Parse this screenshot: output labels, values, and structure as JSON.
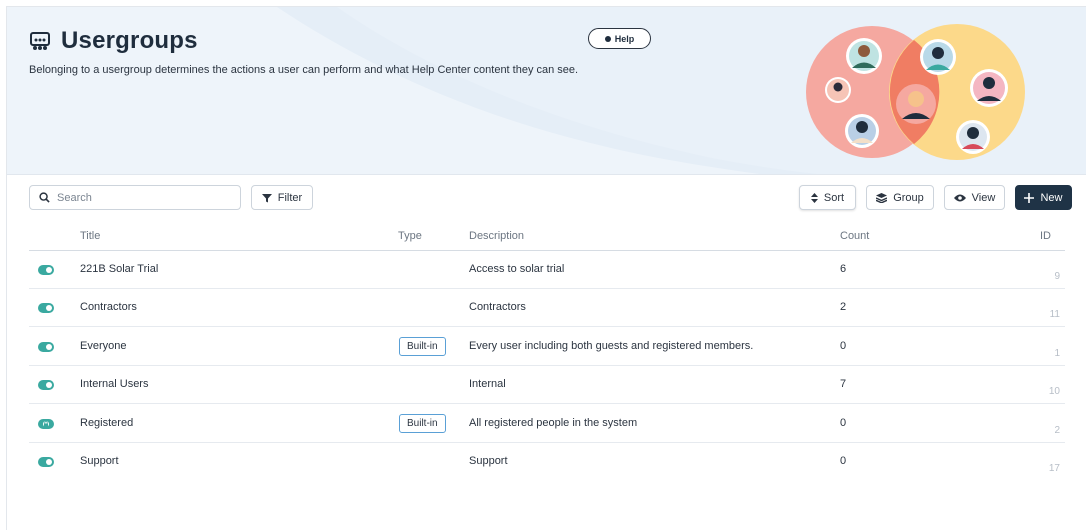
{
  "header": {
    "title": "Usergroups",
    "subtitle": "Belonging to a usergroup determines the actions a user can perform and what Help Center content they can see.",
    "help_label": "Help",
    "title_icon": "usergroup-icon"
  },
  "toolbar": {
    "search_placeholder": "Search",
    "filter_label": "Filter",
    "sort_label": "Sort",
    "group_label": "Group",
    "view_label": "View",
    "new_label": "New"
  },
  "table": {
    "columns": {
      "title": "Title",
      "type": "Type",
      "description": "Description",
      "count": "Count",
      "id": "ID"
    },
    "rows": [
      {
        "title": "221B Solar Trial",
        "type": "",
        "description": "Access to solar trial",
        "count": "6",
        "id": "9",
        "enabled": true,
        "locked": false
      },
      {
        "title": "Contractors",
        "type": "",
        "description": "Contractors",
        "count": "2",
        "id": "11",
        "enabled": true,
        "locked": false
      },
      {
        "title": "Everyone",
        "type": "Built-in",
        "description": "Every user including both guests and registered members.",
        "count": "0",
        "id": "1",
        "enabled": true,
        "locked": false
      },
      {
        "title": "Internal Users",
        "type": "",
        "description": "Internal",
        "count": "7",
        "id": "10",
        "enabled": true,
        "locked": false
      },
      {
        "title": "Registered",
        "type": "Built-in",
        "description": "All registered people in the system",
        "count": "0",
        "id": "2",
        "enabled": true,
        "locked": true
      },
      {
        "title": "Support",
        "type": "",
        "description": "Support",
        "count": "0",
        "id": "17",
        "enabled": true,
        "locked": false
      }
    ]
  },
  "colors": {
    "accent": "#3aa9a0",
    "primary_button": "#1f3346",
    "badge_border": "#5aa0d6",
    "circle_left": "#f5a8a0",
    "circle_right": "#fcd98a"
  }
}
